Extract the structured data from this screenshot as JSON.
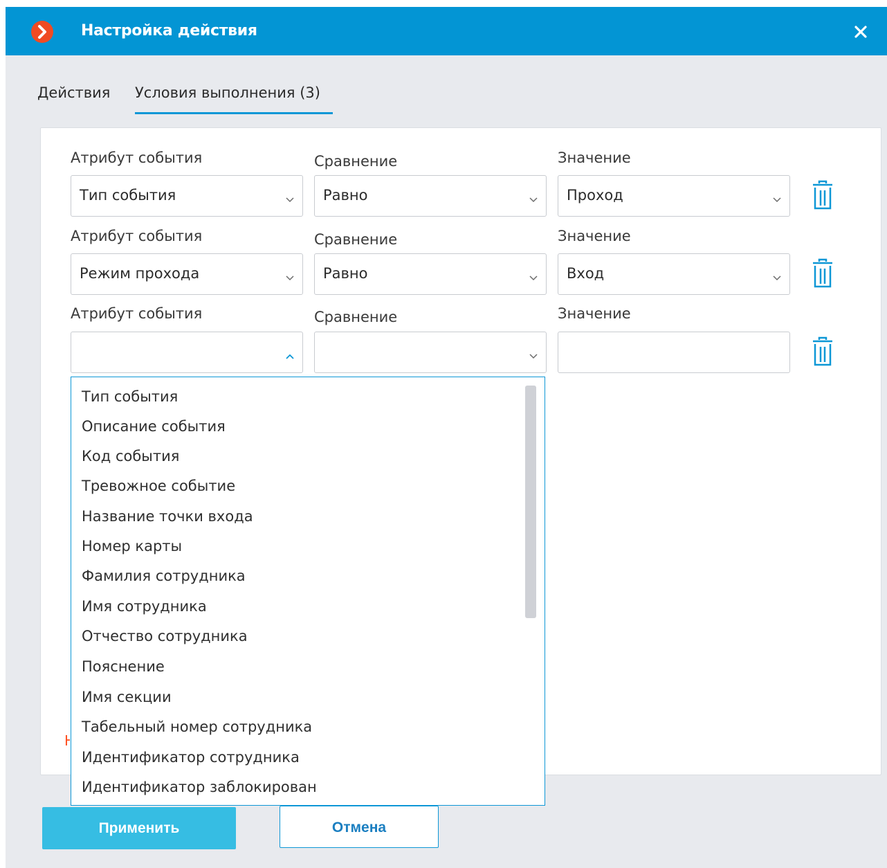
{
  "window": {
    "title": "Настройка действия",
    "close_icon": "close-icon"
  },
  "tabs": [
    {
      "label": "Действия",
      "active": false
    },
    {
      "label": "Условия выполнения (3)",
      "active": true
    }
  ],
  "conditions": [
    {
      "attribute_label": "Атрибут события",
      "comparison_label": "Сравнение",
      "value_label": "Значение",
      "attribute": "Тип события",
      "comparison": "Равно",
      "value": "Проход"
    },
    {
      "attribute_label": "Атрибут события",
      "comparison_label": "Сравнение",
      "value_label": "Значение",
      "attribute": "Режим прохода",
      "comparison": "Равно",
      "value": "Вход"
    },
    {
      "attribute_label": "Атрибут события",
      "comparison_label": "Сравнение",
      "value_label": "Значение",
      "attribute": "",
      "comparison": "",
      "value": ""
    }
  ],
  "attribute_dropdown": {
    "open": true,
    "items": [
      "Тип события",
      "Описание события",
      "Код события",
      "Тревожное событие",
      "Название точки входа",
      "Номер карты",
      "Фамилия сотрудника",
      "Имя сотрудника",
      "Отчество сотрудника",
      "Пояснение",
      "Имя секции",
      "Табельный номер сотрудника",
      "Идентификатор сотрудника",
      "Идентификатор заблокирован"
    ]
  },
  "buttons": {
    "apply": "Применить",
    "cancel": "Отмена"
  },
  "colors": {
    "titlebar": "#0395d4",
    "accent": "#0d97d6",
    "apply_button": "#36bde3",
    "logo": "#f04b23",
    "trash_icon": "#0d97d6"
  }
}
